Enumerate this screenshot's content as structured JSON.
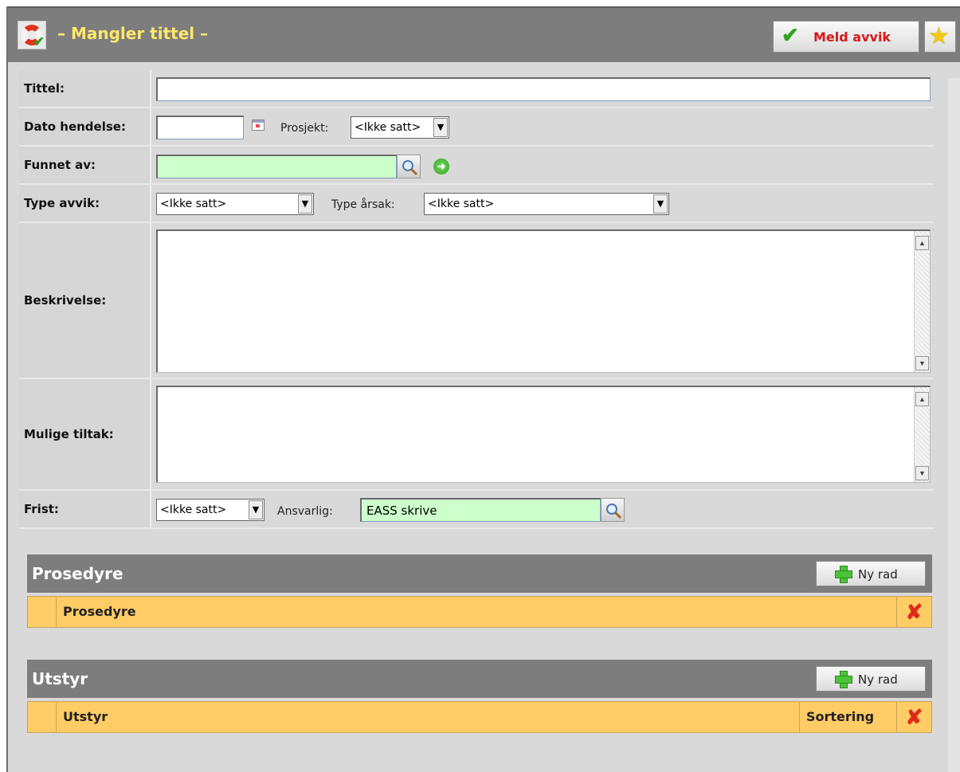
{
  "header": {
    "title": "– Mangler tittel –",
    "meld_avvik_label": "Meld avvik"
  },
  "form": {
    "tittel": {
      "label": "Tittel:",
      "value": ""
    },
    "dato": {
      "label": "Dato hendelse:",
      "value": "",
      "prosjekt_label": "Prosjekt:",
      "prosjekt_value": "<Ikke satt>"
    },
    "funnet": {
      "label": "Funnet av:",
      "value": ""
    },
    "type": {
      "label": "Type avvik:",
      "type_avvik_value": "<Ikke satt>",
      "arsak_label": "Type årsak:",
      "arsak_value": "<Ikke satt>"
    },
    "beskrivelse": {
      "label": "Beskrivelse:",
      "value": ""
    },
    "tiltak": {
      "label": "Mulige tiltak:",
      "value": ""
    },
    "frist": {
      "label": "Frist:",
      "frist_value": "<Ikke satt>",
      "ansvarlig_label": "Ansvarlig:",
      "ansvarlig_value": "EASS skrive"
    }
  },
  "sections": {
    "prosedyre": {
      "title": "Prosedyre",
      "button_label": "Ny rad",
      "column": "Prosedyre"
    },
    "utstyr": {
      "title": "Utstyr",
      "button_label": "Ny rad",
      "column": "Utstyr",
      "sort_column": "Sortering"
    }
  }
}
